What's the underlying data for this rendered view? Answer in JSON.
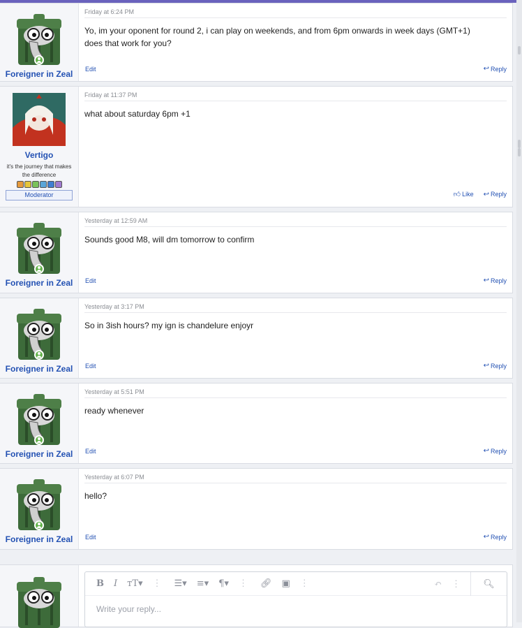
{
  "posts": [
    {
      "author": "Foreigner in Zeal",
      "date": "Friday at 6:24 PM",
      "lines": [
        "Yo, im your oponent for round 2, i can play on weekends, and from 6pm onwards in week days (GMT+1)",
        "does that work for you?"
      ],
      "edit": "Edit",
      "reply": "Reply"
    },
    {
      "author": "Vertigo",
      "user_title": "it's the journey that makes the difference",
      "banner": "Moderator",
      "date": "Friday at 11:37 PM",
      "lines": [
        "what about saturday 6pm +1"
      ],
      "like": "Like",
      "reply": "Reply"
    },
    {
      "author": "Foreigner in Zeal",
      "date": "Yesterday at 12:59 AM",
      "lines": [
        "Sounds good M8, will dm tomorrow to confirm"
      ],
      "edit": "Edit",
      "reply": "Reply"
    },
    {
      "author": "Foreigner in Zeal",
      "date": "Yesterday at 3:17 PM",
      "lines": [
        "So in 3ish hours? my ign is chandelure enjoyr"
      ],
      "edit": "Edit",
      "reply": "Reply"
    },
    {
      "author": "Foreigner in Zeal",
      "date": "Yesterday at 5:51 PM",
      "lines": [
        "ready whenever"
      ],
      "edit": "Edit",
      "reply": "Reply"
    },
    {
      "author": "Foreigner in Zeal",
      "date": "Yesterday at 6:07 PM",
      "lines": [
        "hello?"
      ],
      "edit": "Edit",
      "reply": "Reply"
    }
  ],
  "reply_editor": {
    "placeholder": "Write your reply..."
  },
  "colors": {
    "accent": "#2351b3",
    "top_bar": "#6a62bd",
    "online": "#63b34a"
  },
  "icons": {
    "bold": "bold-icon",
    "italic": "italic-icon",
    "text_size": "text-size-icon",
    "list": "list-icon",
    "align": "align-icon",
    "paragraph": "paragraph-icon",
    "link": "link-icon",
    "image": "image-icon",
    "undo": "undo-icon",
    "preview": "preview-icon"
  }
}
